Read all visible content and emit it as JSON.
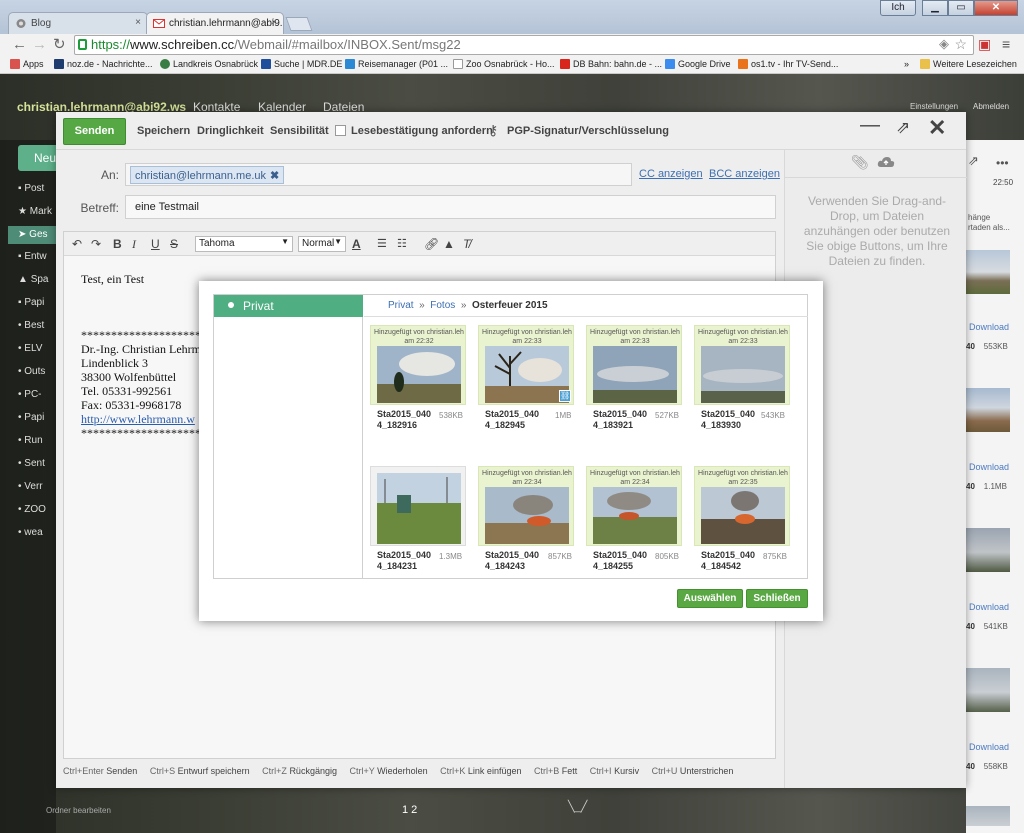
{
  "browser": {
    "tabs": [
      {
        "label": "Blog",
        "close": "×"
      },
      {
        "label": "christian.lehrmann@abi9...",
        "close": "×"
      }
    ],
    "window_user": "Ich",
    "url": {
      "scheme": "https://",
      "domain": "www.schreiben.cc",
      "path": "/Webmail/#mailbox/INBOX.Sent/msg22"
    },
    "bookmarks": [
      {
        "label": "Apps",
        "color": "#d9534f"
      },
      {
        "label": "noz.de - Nachrichte...",
        "color": "#1e3d6e"
      },
      {
        "label": "Landkreis Osnabrück",
        "color": "#3a7d44"
      },
      {
        "label": "Suche | MDR.DE",
        "color": "#1f4e9b"
      },
      {
        "label": "Reisemanager (P01 ...",
        "color": "#2b8ad3"
      },
      {
        "label": "Zoo Osnabrück - Ho...",
        "color": "#eeeeee"
      },
      {
        "label": "DB Bahn: bahn.de - ...",
        "color": "#d9261c"
      },
      {
        "label": "Google Drive",
        "color": "#3c8cf0"
      },
      {
        "label": "os1.tv - Ihr TV-Send...",
        "color": "#e9721b"
      },
      {
        "label": "»",
        "color": ""
      },
      {
        "label": "Weitere Lesezeichen",
        "color": "#e8c04a"
      }
    ]
  },
  "webmail": {
    "user": "christian.lehrmann@abi92.ws",
    "nav": [
      "Kontakte",
      "Kalender",
      "Dateien"
    ],
    "top_right": [
      "Einstellungen",
      "Abmelden"
    ],
    "new_button": "Neu",
    "sidebar": [
      "Post",
      "Mark",
      "Ges",
      "Entw",
      "Spa",
      "Papi",
      "Best",
      "ELV",
      "Outs",
      "PC-",
      "Papi",
      "Run",
      "Sent",
      "Verr",
      "ZOO",
      "wea"
    ],
    "sidebar_footer": "Ordner bearbeiten",
    "pager": "1 2",
    "right_time": "22:50",
    "right_snippet": [
      "hänge",
      "rtaden als..."
    ],
    "right_items": [
      {
        "link": "Download",
        "prefix": "40",
        "size": "553KB"
      },
      {
        "link": "Download",
        "prefix": "40",
        "size": "1.1MB"
      },
      {
        "link": "Download",
        "prefix": "40",
        "size": "541KB"
      },
      {
        "link": "Download",
        "prefix": "40",
        "size": "558KB"
      }
    ]
  },
  "compose": {
    "send": "Senden",
    "save": "Speichern",
    "urgency": "Dringlichkeit",
    "sensitivity": "Sensibilität",
    "read_receipt": "Lesebestätigung anfordern",
    "pgp": "PGP-Signatur/Verschlüsselung",
    "to_label": "An:",
    "to_chip": "christian@lehrmann.me.uk",
    "cc": "CC anzeigen",
    "bcc": "BCC anzeigen",
    "subject_label": "Betreff:",
    "subject": "eine Testmail",
    "font": "Tahoma",
    "size": "Normal",
    "body": [
      "Test, ein Test",
      "",
      "",
      "********************",
      "Dr.-Ing. Christian Lehrm",
      "Lindenblick 3",
      "38300 Wolfenbüttel",
      "Tel. 05331-992561",
      "Fax: 05331-9968178",
      "http://www.lehrmann.w",
      "********************"
    ],
    "attach_hint": "Verwenden Sie Drag-and-Drop, um Dateien anzuhängen oder benutzen Sie obige Buttons, um Ihre Dateien zu finden.",
    "shortcuts": [
      {
        "key": "Ctrl+Enter",
        "action": "Senden"
      },
      {
        "key": "Ctrl+S",
        "action": "Entwurf speichern"
      },
      {
        "key": "Ctrl+Z",
        "action": "Rückgängig"
      },
      {
        "key": "Ctrl+Y",
        "action": "Wiederholen"
      },
      {
        "key": "Ctrl+K",
        "action": "Link einfügen"
      },
      {
        "key": "Ctrl+B",
        "action": "Fett"
      },
      {
        "key": "Ctrl+I",
        "action": "Kursiv"
      },
      {
        "key": "Ctrl+U",
        "action": "Unterstrichen"
      }
    ]
  },
  "picker": {
    "folder": "Privat",
    "breadcrumb": [
      "Privat",
      "Fotos",
      "Osterfeuer 2015"
    ],
    "files": [
      {
        "hint1": "Hinzugefügt von christian.leh",
        "hint2": "am 22:32",
        "name1": "Sta2015_040",
        "name2": "4_182916",
        "size": "538KB",
        "scene": "smoke"
      },
      {
        "hint1": "Hinzugefügt von christian.leh",
        "hint2": "am 22:33",
        "name1": "Sta2015_040",
        "name2": "4_182945",
        "size": "1MB",
        "scene": "tree",
        "linked": true
      },
      {
        "hint1": "Hinzugefügt von christian.leh",
        "hint2": "am 22:33",
        "name1": "Sta2015_040",
        "name2": "4_183921",
        "size": "527KB",
        "scene": "sky"
      },
      {
        "hint1": "Hinzugefügt von christian.leh",
        "hint2": "am 22:33",
        "name1": "Sta2015_040",
        "name2": "4_183930",
        "size": "543KB",
        "scene": "haze"
      },
      {
        "hint1": "",
        "hint2": "",
        "name1": "Sta2015_040",
        "name2": "4_184231",
        "size": "1.3MB",
        "scene": "field"
      },
      {
        "hint1": "Hinzugefügt von christian.leh",
        "hint2": "am 22:34",
        "name1": "Sta2015_040",
        "name2": "4_184243",
        "size": "857KB",
        "scene": "fire"
      },
      {
        "hint1": "Hinzugefügt von christian.leh",
        "hint2": "am 22:34",
        "name1": "Sta2015_040",
        "name2": "4_184255",
        "size": "805KB",
        "scene": "fire2"
      },
      {
        "hint1": "Hinzugefügt von christian.leh",
        "hint2": "am 22:35",
        "name1": "Sta2015_040",
        "name2": "4_184542",
        "size": "875KB",
        "scene": "fire3"
      }
    ],
    "select": "Auswählen",
    "close": "Schließen"
  },
  "colors": {
    "accent": "#56a845",
    "folder_green": "#4fae82",
    "link": "#3c6fb3",
    "card_bg": "#eaf3cf"
  }
}
